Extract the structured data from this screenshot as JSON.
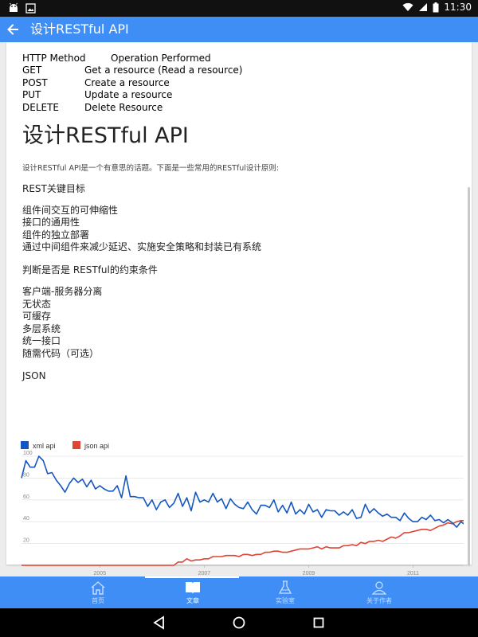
{
  "status_bar": {
    "time": "11:30",
    "left_icons": [
      "android-icon",
      "image-icon"
    ],
    "right_icons": [
      "wifi-icon",
      "signal-icon",
      "battery-icon"
    ]
  },
  "app_bar": {
    "title": "设计RESTful API",
    "back_icon": "back-arrow-icon"
  },
  "http_table": {
    "header": {
      "method": "HTTP Method",
      "operation": "Operation Performed"
    },
    "rows": [
      {
        "method": "GET",
        "operation": "Get a resource (Read a resource)"
      },
      {
        "method": "POST",
        "operation": "Create a resource"
      },
      {
        "method": "PUT",
        "operation": "Update a resource"
      },
      {
        "method": "DELETE",
        "operation": "Delete Resource"
      }
    ]
  },
  "article": {
    "heading": "设计RESTful API",
    "intro": "设计RESTful API是一个有意思的话题。下面是一些常用的RESTful设计原则:",
    "goals_title": "REST关键目标",
    "goals": [
      "组件间交互的可伸缩性",
      "接口的通用性",
      "组件的独立部署",
      "通过中间组件来减少延迟、实施安全策略和封装已有系统"
    ],
    "constraints_title": "判断是否是 RESTful的约束条件",
    "constraints": [
      "客户端-服务器分离",
      "无状态",
      "可缓存",
      "多层系统",
      "统一接口",
      "随需代码（可选）"
    ],
    "json_title": "JSON"
  },
  "chart_data": {
    "type": "line",
    "legend": {
      "placement": "top-left"
    },
    "x_ticks": [
      "2005",
      "2007",
      "2009",
      "2011"
    ],
    "y_ticks": [
      100,
      80,
      60,
      40,
      20
    ],
    "ylim": [
      0,
      100
    ],
    "grid": true,
    "x": [
      "2004-01",
      "2004-02",
      "2004-03",
      "2004-04",
      "2004-05",
      "2004-06",
      "2004-07",
      "2004-08",
      "2004-09",
      "2004-10",
      "2004-11",
      "2004-12",
      "2005-01",
      "2005-02",
      "2005-03",
      "2005-04",
      "2005-05",
      "2005-06",
      "2005-07",
      "2005-08",
      "2005-09",
      "2005-10",
      "2005-11",
      "2005-12",
      "2006-01",
      "2006-02",
      "2006-03",
      "2006-04",
      "2006-05",
      "2006-06",
      "2006-07",
      "2006-08",
      "2006-09",
      "2006-10",
      "2006-11",
      "2006-12",
      "2007-01",
      "2007-02",
      "2007-03",
      "2007-04",
      "2007-05",
      "2007-06",
      "2007-07",
      "2007-08",
      "2007-09",
      "2007-10",
      "2007-11",
      "2007-12",
      "2008-01",
      "2008-02",
      "2008-03",
      "2008-04",
      "2008-05",
      "2008-06",
      "2008-07",
      "2008-08",
      "2008-09",
      "2008-10",
      "2008-11",
      "2008-12",
      "2009-01",
      "2009-02",
      "2009-03",
      "2009-04",
      "2009-05",
      "2009-06",
      "2009-07",
      "2009-08",
      "2009-09",
      "2009-10",
      "2009-11",
      "2009-12",
      "2010-01",
      "2010-02",
      "2010-03",
      "2010-04",
      "2010-05",
      "2010-06",
      "2010-07",
      "2010-08",
      "2010-09",
      "2010-10",
      "2010-11",
      "2010-12",
      "2011-01",
      "2011-02",
      "2011-03",
      "2011-04",
      "2011-05",
      "2011-06",
      "2011-07",
      "2011-08",
      "2011-09",
      "2011-10",
      "2011-11",
      "2011-12",
      "2012-01",
      "2012-02",
      "2012-03",
      "2012-04",
      "2012-05",
      "2012-06",
      "2012-07",
      "2012-08",
      "2012-09"
    ],
    "series": [
      {
        "name": "xml api",
        "color": "#1557c0",
        "values": [
          80,
          96,
          90,
          90,
          100,
          96,
          84,
          85,
          78,
          73,
          67,
          75,
          80,
          76,
          79,
          72,
          78,
          70,
          73,
          70,
          68,
          68,
          73,
          62,
          82,
          63,
          63,
          62,
          62,
          54,
          60,
          51,
          58,
          60,
          53,
          57,
          66,
          54,
          62,
          50,
          67,
          58,
          60,
          58,
          66,
          58,
          61,
          52,
          61,
          56,
          53,
          52,
          58,
          51,
          47,
          55,
          55,
          53,
          60,
          49,
          55,
          48,
          58,
          47,
          51,
          47,
          56,
          49,
          51,
          44,
          51,
          50,
          50,
          46,
          49,
          46,
          51,
          43,
          44,
          56,
          48,
          52,
          48,
          45,
          47,
          44,
          44,
          41,
          48,
          43,
          40,
          40,
          44,
          42,
          46,
          41,
          42,
          39,
          42,
          39,
          35,
          40,
          37,
          42,
          36
        ]
      },
      {
        "name": "json api",
        "color": "#e04434",
        "values": [
          0,
          0,
          0,
          0,
          0,
          0,
          0,
          0,
          0,
          0,
          0,
          0,
          0,
          0,
          0,
          0,
          0,
          0,
          0,
          0,
          0,
          0,
          0,
          0,
          0,
          0,
          0,
          0,
          0,
          0,
          0,
          0,
          0,
          0,
          0,
          0,
          3,
          3,
          6,
          4,
          5,
          5,
          6,
          6,
          8,
          8,
          8,
          9,
          9,
          9,
          8,
          10,
          10,
          9,
          10,
          10,
          12,
          12,
          13,
          13,
          12,
          12,
          13,
          14,
          15,
          15,
          15,
          16,
          17,
          15,
          17,
          16,
          16,
          16,
          18,
          18,
          19,
          18,
          21,
          20,
          22,
          22,
          23,
          22,
          24,
          26,
          25,
          27,
          30,
          30,
          31,
          32,
          33,
          33,
          32,
          34,
          36,
          37,
          39,
          38,
          40,
          41,
          41,
          40,
          40
        ]
      }
    ]
  },
  "bottom_nav": [
    {
      "label": "首页",
      "icon": "home-icon",
      "active": false
    },
    {
      "label": "文章",
      "icon": "book-icon",
      "active": true
    },
    {
      "label": "实验室",
      "icon": "flask-icon",
      "active": false
    },
    {
      "label": "关于作者",
      "icon": "person-icon",
      "active": false
    }
  ],
  "system_nav": [
    "back-triangle-icon",
    "home-circle-icon",
    "recents-square-icon"
  ]
}
